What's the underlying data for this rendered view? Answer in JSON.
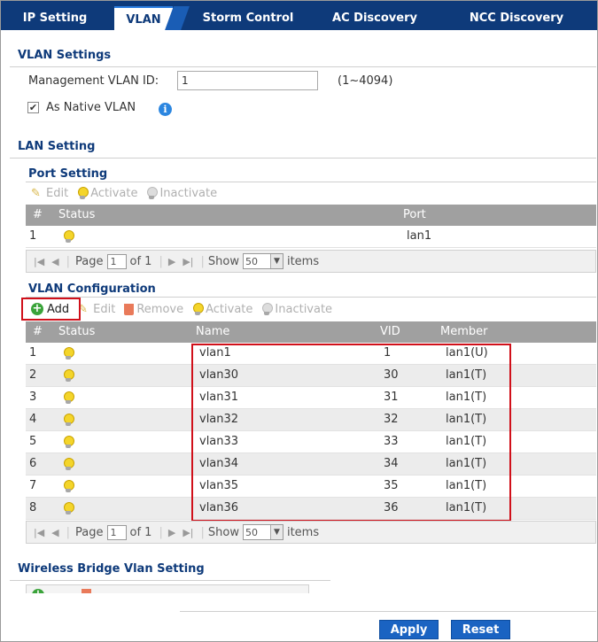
{
  "tabs": [
    {
      "label": "IP Setting",
      "active": false
    },
    {
      "label": "VLAN",
      "active": true
    },
    {
      "label": "Storm Control",
      "active": false
    },
    {
      "label": "AC Discovery",
      "active": false
    },
    {
      "label": "NCC Discovery",
      "active": false
    }
  ],
  "vlan_settings": {
    "title": "VLAN Settings",
    "management_label": "Management VLAN ID:",
    "management_value": "1",
    "management_range": "(1~4094)",
    "native_label": "As Native VLAN",
    "native_checked": true
  },
  "lan_setting": {
    "title": "LAN Setting",
    "port_setting": {
      "title": "Port Setting",
      "toolbar": {
        "edit": "Edit",
        "activate": "Activate",
        "inactivate": "Inactivate"
      },
      "columns": {
        "num": "#",
        "status": "Status",
        "port": "Port"
      },
      "rows": [
        {
          "num": "1",
          "port": "lan1"
        }
      ],
      "pager": {
        "page_label": "Page",
        "page_value": "1",
        "of_label": "of 1",
        "show_label": "Show",
        "show_value": "50",
        "items_label": "items"
      }
    },
    "vlan_config": {
      "title": "VLAN Configuration",
      "toolbar": {
        "add": "Add",
        "edit": "Edit",
        "remove": "Remove",
        "activate": "Activate",
        "inactivate": "Inactivate"
      },
      "columns": {
        "num": "#",
        "status": "Status",
        "name": "Name",
        "vid": "VID",
        "member": "Member"
      },
      "rows": [
        {
          "num": "1",
          "name": "vlan1",
          "vid": "1",
          "member": "lan1(U)"
        },
        {
          "num": "2",
          "name": "vlan30",
          "vid": "30",
          "member": "lan1(T)"
        },
        {
          "num": "3",
          "name": "vlan31",
          "vid": "31",
          "member": "lan1(T)"
        },
        {
          "num": "4",
          "name": "vlan32",
          "vid": "32",
          "member": "lan1(T)"
        },
        {
          "num": "5",
          "name": "vlan33",
          "vid": "33",
          "member": "lan1(T)"
        },
        {
          "num": "6",
          "name": "vlan34",
          "vid": "34",
          "member": "lan1(T)"
        },
        {
          "num": "7",
          "name": "vlan35",
          "vid": "35",
          "member": "lan1(T)"
        },
        {
          "num": "8",
          "name": "vlan36",
          "vid": "36",
          "member": "lan1(T)"
        }
      ],
      "pager": {
        "page_label": "Page",
        "page_value": "1",
        "of_label": "of 1",
        "show_label": "Show",
        "show_value": "50",
        "items_label": "items"
      }
    }
  },
  "wireless_bridge": {
    "title": "Wireless Bridge Vlan Setting"
  },
  "footer": {
    "apply": "Apply",
    "reset": "Reset"
  },
  "colors": {
    "nav": "#0e3a7a",
    "accent": "#1a63c2",
    "highlight": "#d0101a",
    "header_gray": "#a0a0a0"
  },
  "icons": {
    "status": "bulb-icon",
    "info": "info-icon",
    "add": "plus-circle-icon",
    "remove": "trash-icon",
    "edit": "pencil-icon"
  }
}
